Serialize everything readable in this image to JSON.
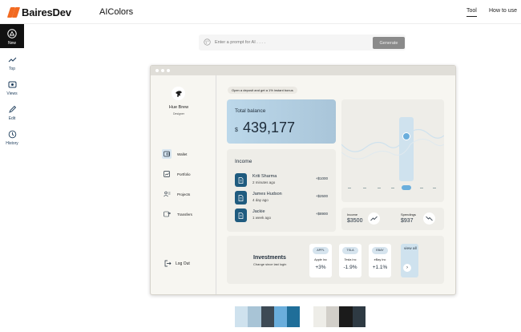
{
  "header": {
    "brand": "BairesDev",
    "app_title": "AIColors",
    "nav": [
      "Tool",
      "How to use"
    ]
  },
  "sidebar": {
    "items": [
      {
        "label": "New",
        "icon": "new-icon"
      },
      {
        "label": "Top",
        "icon": "trending-icon"
      },
      {
        "label": "Views",
        "icon": "views-icon"
      },
      {
        "label": "Edit",
        "icon": "pencil-icon"
      },
      {
        "label": "History",
        "icon": "history-icon"
      }
    ]
  },
  "prompt": {
    "placeholder": "Enter a prompt for AI . . . .",
    "button": "Generate"
  },
  "preview": {
    "user": {
      "name": "Hue Brew",
      "role": "Designer"
    },
    "menu": [
      {
        "label": "Wallet"
      },
      {
        "label": "Portfolio"
      },
      {
        "label": "Projects"
      },
      {
        "label": "Transfers"
      }
    ],
    "logout": "Log Out",
    "banner": "Open a deposit and get a 1% instant bonus",
    "balance": {
      "title": "Total balance",
      "currency": "$",
      "value": "439,177"
    },
    "income": {
      "title": "Income",
      "rows": [
        {
          "name": "Kriti Sharma",
          "time": "2 minutes ago",
          "amount": "+$1000"
        },
        {
          "name": "James Hudson",
          "time": "4 day ago",
          "amount": "+$2500"
        },
        {
          "name": "Jackie",
          "time": "1 week ago",
          "amount": "+$8900"
        }
      ]
    },
    "stats": {
      "income_label": "Income",
      "income_value": "$3500",
      "spend_label": "Spendings",
      "spend_value": "$937"
    },
    "investments": {
      "title": "Investments",
      "subtitle": "Change since last login",
      "stocks": [
        {
          "ticker": "APPL",
          "name": "Apple Inc",
          "change": "+3%"
        },
        {
          "ticker": "TSLA",
          "name": "Tesla Inc",
          "change": "-1.9%"
        },
        {
          "ticker": "EBAY",
          "name": "eBay Inc",
          "change": "+1.1%"
        }
      ],
      "view_all": "view all"
    }
  },
  "colors": {
    "palette": [
      "#cfe2ee",
      "#a8c4d6",
      "#3d4a55",
      "#6aaedc",
      "#1f6e99",
      "#ffffff",
      "#eeede8",
      "#d2cfc9",
      "#1b1b1b",
      "#2e3a43"
    ],
    "accent": "#f26a21"
  }
}
